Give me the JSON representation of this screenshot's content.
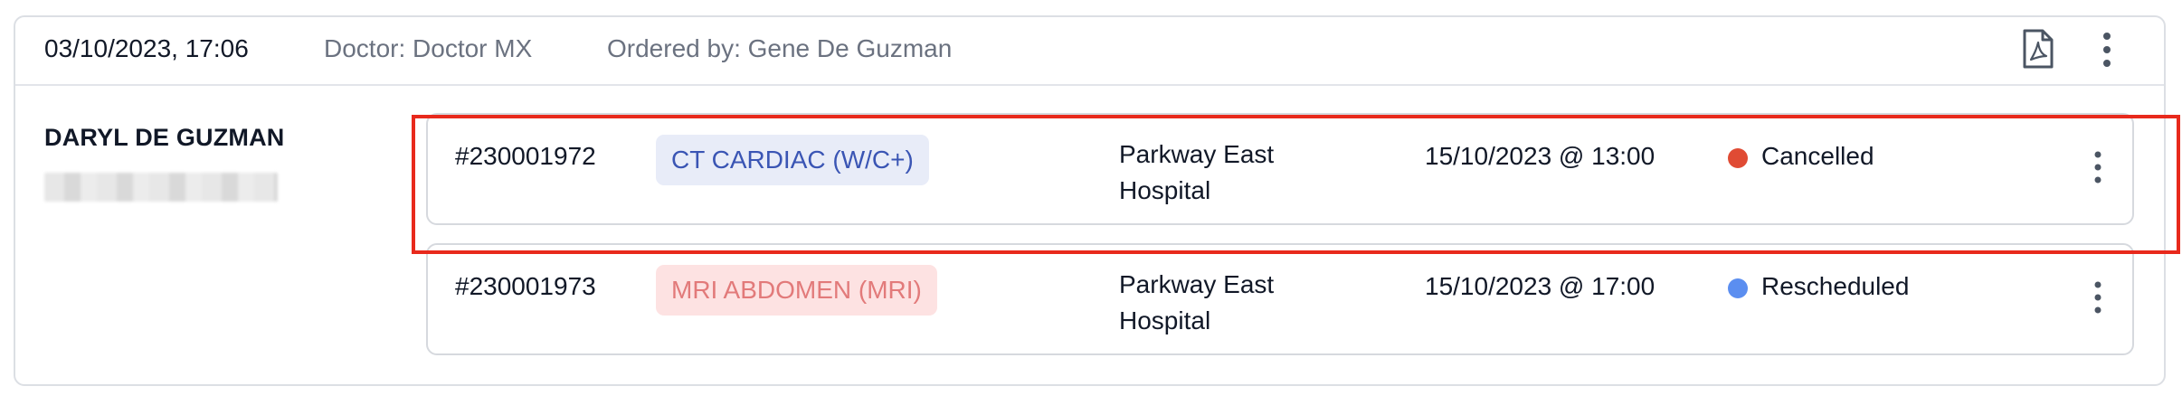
{
  "header": {
    "datetime": "03/10/2023, 17:06",
    "doctor": "Doctor: Doctor MX",
    "ordered_by": "Ordered by: Gene De Guzman"
  },
  "icons": {
    "pdf": "pdf-file-icon",
    "more": "vertical-ellipsis-icon"
  },
  "patient": {
    "name": "DARYL DE GUZMAN"
  },
  "orders": [
    {
      "id": "#230001972",
      "procedure": "CT CARDIAC (W/C+)",
      "location_line1": "Parkway East",
      "location_line2": "Hospital",
      "appointment": "15/10/2023 @ 13:00",
      "status": "Cancelled",
      "status_color": "#e04b34",
      "tag_color": "#3a55b4"
    },
    {
      "id": "#230001973",
      "procedure": "MRI ABDOMEN (MRI)",
      "location_line1": "Parkway East",
      "location_line2": "Hospital",
      "appointment": "15/10/2023 @ 17:00",
      "status": "Rescheduled",
      "status_color": "#5b8ef0",
      "tag_color": "#e27a7a"
    }
  ],
  "highlight_color": "#e8291c"
}
